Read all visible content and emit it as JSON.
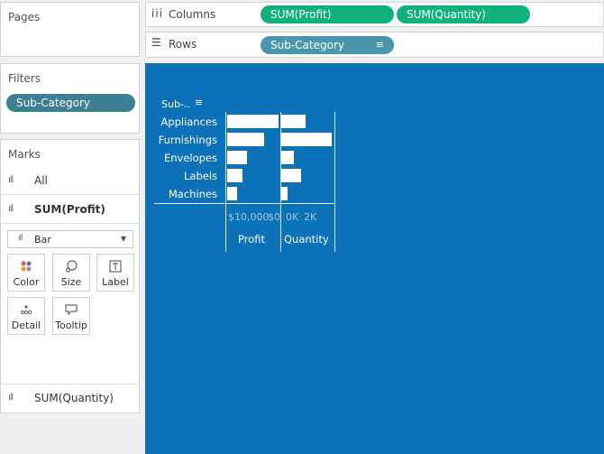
{
  "pages": {
    "title": "Pages"
  },
  "columns": {
    "label": "Columns",
    "pills": [
      "SUM(Profit)",
      "SUM(Quantity)"
    ]
  },
  "rows": {
    "label": "Rows",
    "pills": [
      "Sub-Category"
    ]
  },
  "filters": {
    "title": "Filters",
    "pills": [
      "Sub-Category"
    ]
  },
  "marks": {
    "title": "Marks",
    "all_label": "All",
    "profit_label": "SUM(Profit)",
    "mark_type": "Bar",
    "buttons": [
      "Color",
      "Size",
      "Label",
      "Detail",
      "Tooltip"
    ],
    "quantity_label": "SUM(Quantity)"
  },
  "view": {
    "row_header": "Sub-..",
    "categories": [
      "Appliances",
      "Furnishings",
      "Envelopes",
      "Labels",
      "Machines"
    ],
    "profit_ticks": [
      "$10,000",
      "$0"
    ],
    "quantity_ticks": [
      "0K",
      "2K"
    ],
    "profit_axis_title": "Profit",
    "quantity_axis_title": "Quantity"
  },
  "colors": {
    "canvas": "#0b72b9",
    "column_pill": "#0fb279",
    "row_pill": "#4a97ad",
    "filter_pill": "#3f7f93"
  },
  "chart_data": {
    "type": "bar",
    "categories": [
      "Appliances",
      "Furnishings",
      "Envelopes",
      "Labels",
      "Machines"
    ],
    "series": [
      {
        "name": "Profit",
        "values": [
          18100,
          13000,
          6900,
          5500,
          3400
        ]
      },
      {
        "name": "Quantity",
        "values": [
          1730,
          3560,
          900,
          1400,
          440
        ]
      }
    ]
  }
}
